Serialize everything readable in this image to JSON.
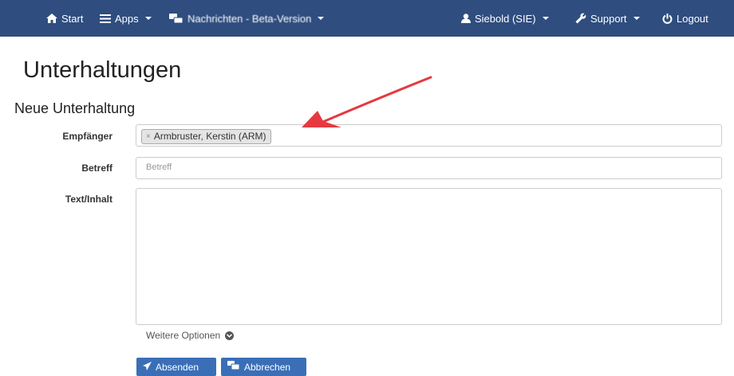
{
  "nav": {
    "start": "Start",
    "apps": "Apps",
    "messages": "Nachrichten - Beta-Version",
    "user": "Siebold (SIE)",
    "support": "Support",
    "logout": "Logout"
  },
  "page_title": "Unterhaltungen",
  "section_title": "Neue Unterhaltung",
  "form": {
    "recipient_label": "Empfänger",
    "recipient_tag": "Armbruster, Kerstin (ARM)",
    "recipient_remove": "×",
    "subject_label": "Betreff",
    "subject_placeholder": "Betreff",
    "body_label": "Text/Inhalt",
    "more_options": "Weitere Optionen"
  },
  "buttons": {
    "send": "Absenden",
    "cancel": "Abbrechen"
  },
  "colors": {
    "navbar": "#2f4d7f",
    "button": "#3a6fb7",
    "arrow": "#e5393f"
  }
}
